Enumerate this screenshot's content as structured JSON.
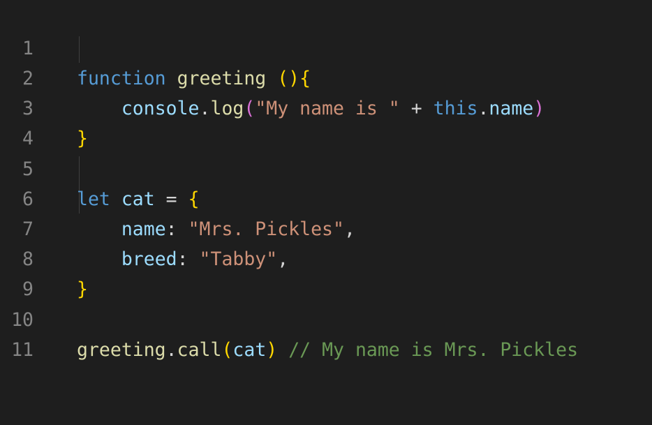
{
  "editor": {
    "lines": [
      {
        "number": "1",
        "tokens": [
          {
            "text": "function",
            "type": "keyword"
          },
          {
            "text": " ",
            "type": "plain"
          },
          {
            "text": "greeting",
            "type": "function"
          },
          {
            "text": " ",
            "type": "plain"
          },
          {
            "text": "()",
            "type": "bracket1"
          },
          {
            "text": "{",
            "type": "bracket1"
          }
        ]
      },
      {
        "number": "2",
        "tokens": [
          {
            "text": "    ",
            "type": "plain"
          },
          {
            "text": "console",
            "type": "variable"
          },
          {
            "text": ".",
            "type": "plain"
          },
          {
            "text": "log",
            "type": "function"
          },
          {
            "text": "(",
            "type": "bracket2"
          },
          {
            "text": "\"My name is \"",
            "type": "string"
          },
          {
            "text": " + ",
            "type": "plain"
          },
          {
            "text": "this",
            "type": "keyword"
          },
          {
            "text": ".",
            "type": "plain"
          },
          {
            "text": "name",
            "type": "variable"
          },
          {
            "text": ")",
            "type": "bracket2"
          }
        ]
      },
      {
        "number": "3",
        "tokens": [
          {
            "text": "}",
            "type": "bracket1"
          }
        ]
      },
      {
        "number": "4",
        "tokens": []
      },
      {
        "number": "5",
        "tokens": [
          {
            "text": "let",
            "type": "keyword"
          },
          {
            "text": " ",
            "type": "plain"
          },
          {
            "text": "cat",
            "type": "variable"
          },
          {
            "text": " = ",
            "type": "plain"
          },
          {
            "text": "{",
            "type": "bracket1"
          }
        ]
      },
      {
        "number": "6",
        "tokens": [
          {
            "text": "    ",
            "type": "plain"
          },
          {
            "text": "name",
            "type": "variable"
          },
          {
            "text": ": ",
            "type": "plain"
          },
          {
            "text": "\"Mrs. Pickles\"",
            "type": "string"
          },
          {
            "text": ",",
            "type": "plain"
          }
        ]
      },
      {
        "number": "7",
        "tokens": [
          {
            "text": "    ",
            "type": "plain"
          },
          {
            "text": "breed",
            "type": "variable"
          },
          {
            "text": ": ",
            "type": "plain"
          },
          {
            "text": "\"Tabby\"",
            "type": "string"
          },
          {
            "text": ",",
            "type": "plain"
          }
        ]
      },
      {
        "number": "8",
        "tokens": [
          {
            "text": "}",
            "type": "bracket1"
          }
        ]
      },
      {
        "number": "9",
        "tokens": []
      },
      {
        "number": "10",
        "tokens": [
          {
            "text": "greeting",
            "type": "function"
          },
          {
            "text": ".",
            "type": "plain"
          },
          {
            "text": "call",
            "type": "function"
          },
          {
            "text": "(",
            "type": "bracket1"
          },
          {
            "text": "cat",
            "type": "variable"
          },
          {
            "text": ")",
            "type": "bracket1"
          },
          {
            "text": " ",
            "type": "plain"
          },
          {
            "text": "// My name is Mrs. Pickles",
            "type": "comment"
          }
        ]
      },
      {
        "number": "11",
        "tokens": []
      }
    ]
  }
}
